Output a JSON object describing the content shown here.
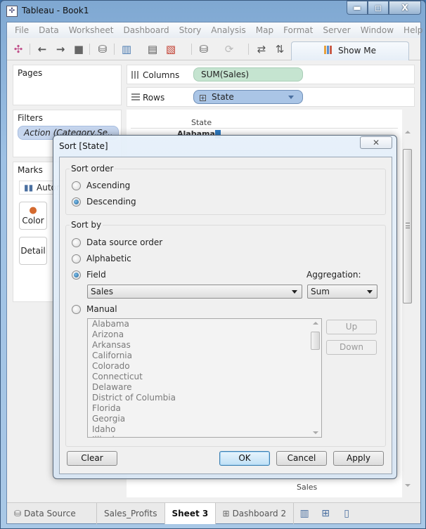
{
  "window": {
    "title": "Tableau - Book1",
    "controls": {
      "minimize": "▬",
      "maximize": "◻",
      "close": "X"
    }
  },
  "menu": [
    "File",
    "Data",
    "Worksheet",
    "Dashboard",
    "Story",
    "Analysis",
    "Map",
    "Format",
    "Server",
    "Window",
    "Help"
  ],
  "toolbar": {
    "icons": [
      {
        "name": "tableau-logo-icon",
        "glyph": "✣"
      },
      {
        "name": "undo-icon",
        "glyph": "←"
      },
      {
        "name": "redo-icon",
        "glyph": "→"
      },
      {
        "name": "save-icon",
        "glyph": "■"
      },
      {
        "name": "new-data-source-icon",
        "glyph": "⛁"
      },
      {
        "name": "new-worksheet-icon",
        "glyph": "▥"
      },
      {
        "name": "duplicate-sheet-icon",
        "glyph": "▤"
      },
      {
        "name": "clear-sheet-icon",
        "glyph": "▧"
      },
      {
        "name": "pause-updates-icon",
        "glyph": "⛁"
      },
      {
        "name": "refresh-icon",
        "glyph": "⟳"
      },
      {
        "name": "swap-icon",
        "glyph": "⇄"
      },
      {
        "name": "sort-ascending-icon",
        "glyph": "⇅"
      }
    ],
    "show_me": "Show Me"
  },
  "panels": {
    "pages": "Pages",
    "filters": "Filters",
    "filter_pill": "Action (Category,Se..",
    "marks": "Marks",
    "marks_type": "Automatic",
    "marks_buttons": [
      "Color",
      "Detail"
    ]
  },
  "shelves": {
    "columns_label": "Columns",
    "columns_pill": "SUM(Sales)",
    "rows_label": "Rows",
    "rows_pill": "State"
  },
  "viz": {
    "header": "State",
    "first_row": "Alabama",
    "axis_label": "Sales"
  },
  "dialog": {
    "title": "Sort [State]",
    "sort_order": {
      "label": "Sort order",
      "options": [
        "Ascending",
        "Descending"
      ],
      "selected": "Descending"
    },
    "sort_by": {
      "label": "Sort by",
      "options": [
        "Data source order",
        "Alphabetic",
        "Field",
        "Manual"
      ],
      "selected": "Field",
      "field_value": "Sales",
      "aggregation_label": "Aggregation:",
      "aggregation_value": "Sum",
      "manual_items": [
        "Alabama",
        "Arizona",
        "Arkansas",
        "California",
        "Colorado",
        "Connecticut",
        "Delaware",
        "District of Columbia",
        "Florida",
        "Georgia",
        "Idaho",
        "Illinois"
      ],
      "up": "Up",
      "down": "Down"
    },
    "buttons": {
      "clear": "Clear",
      "ok": "OK",
      "cancel": "Cancel",
      "apply": "Apply"
    }
  },
  "tabs": [
    {
      "label": "Data Source",
      "active": false
    },
    {
      "label": "Sales_Profits",
      "active": false
    },
    {
      "label": "Sheet 3",
      "active": true
    },
    {
      "label": "Dashboard 2",
      "active": false
    }
  ]
}
